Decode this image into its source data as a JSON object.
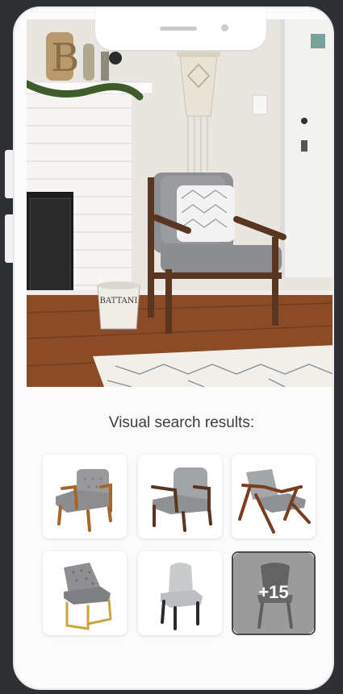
{
  "results": {
    "title": "Visual search results:",
    "more_count": "+15"
  },
  "photo": {
    "pot_label": "BATTANI"
  },
  "colors": {
    "phone_body": "#fbfbfb",
    "background": "#2e3033",
    "title_text": "#3d3d3d",
    "chair_gray": "#8a8a8c",
    "wood": "#6a3f24"
  },
  "icons": [
    "chair-thumbnail",
    "scene-photo"
  ]
}
